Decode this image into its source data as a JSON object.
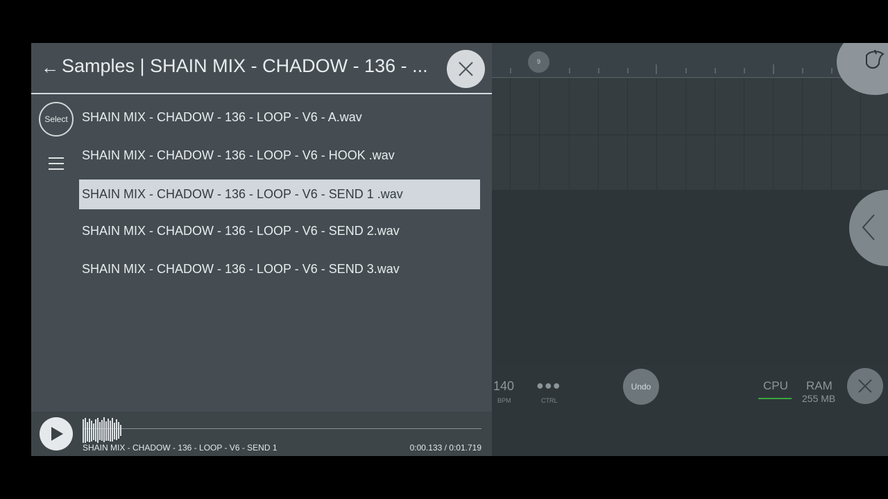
{
  "browser": {
    "back_arrow": "←",
    "title": "Samples | SHAIN MIX - CHADOW - 136 - ...",
    "select_label": "Select",
    "files": [
      {
        "name": "SHAIN MIX - CHADOW - 136 - LOOP - V6 - A.wav",
        "selected": false
      },
      {
        "name": "SHAIN MIX - CHADOW - 136 - LOOP - V6 - HOOK .wav",
        "selected": false
      },
      {
        "name": "SHAIN MIX - CHADOW - 136 - LOOP - V6 - SEND 1 .wav",
        "selected": true
      },
      {
        "name": "SHAIN MIX - CHADOW - 136 - LOOP - V6 - SEND 2.wav",
        "selected": false
      },
      {
        "name": "SHAIN MIX - CHADOW - 136 - LOOP - V6 - SEND 3.wav",
        "selected": false
      }
    ]
  },
  "player": {
    "sample_name": "SHAIN MIX - CHADOW - 136 - LOOP - V6 - SEND 1",
    "time": "0:00.133 / 0:01.719"
  },
  "timeline": {
    "marker": "9"
  },
  "transport": {
    "bpm_value": "140",
    "bpm_label": "BPM",
    "ctrl_dots": "●●●",
    "ctrl_label": "CTRL",
    "undo_label": "Undo",
    "cpu_label": "CPU",
    "ram_label": "RAM",
    "ram_value": "255 MB"
  },
  "colors": {
    "panel_bg": "#454d52",
    "selected_row": "#d1d7dc",
    "cpu_meter": "#3aa540",
    "daw_bg": "#2e3538"
  },
  "icons": {
    "close": "close-icon",
    "play": "play-icon",
    "menu": "menu-icon",
    "logo": "fl-studio-logo-icon",
    "side": "chevron-left-icon"
  }
}
